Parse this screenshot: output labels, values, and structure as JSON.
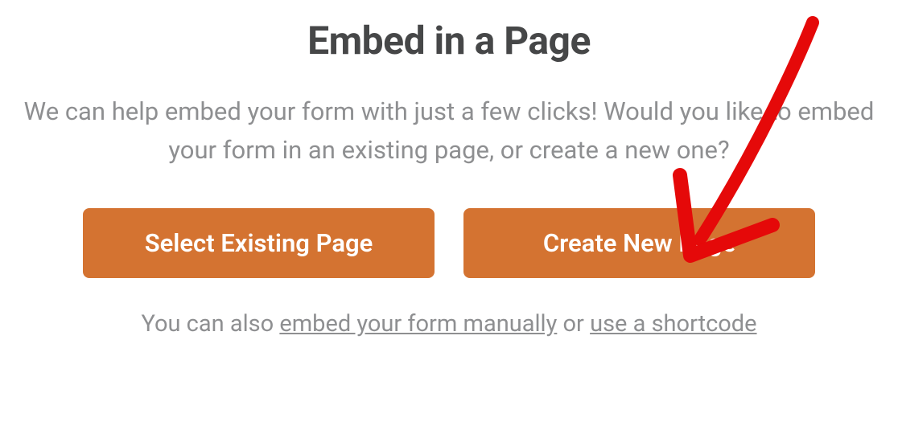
{
  "modal": {
    "title": "Embed in a Page",
    "description": "We can help embed your form with just a few clicks! Would you like to embed your form in an existing page, or create a new one?",
    "buttons": {
      "select_existing": "Select Existing Page",
      "create_new": "Create New Page"
    },
    "footer": {
      "prefix": "You can also ",
      "link_manual": "embed your form manually",
      "middle": " or ",
      "link_shortcode": "use a shortcode"
    }
  },
  "annotation": {
    "color": "#e50909",
    "target": "create-new-page-button"
  }
}
